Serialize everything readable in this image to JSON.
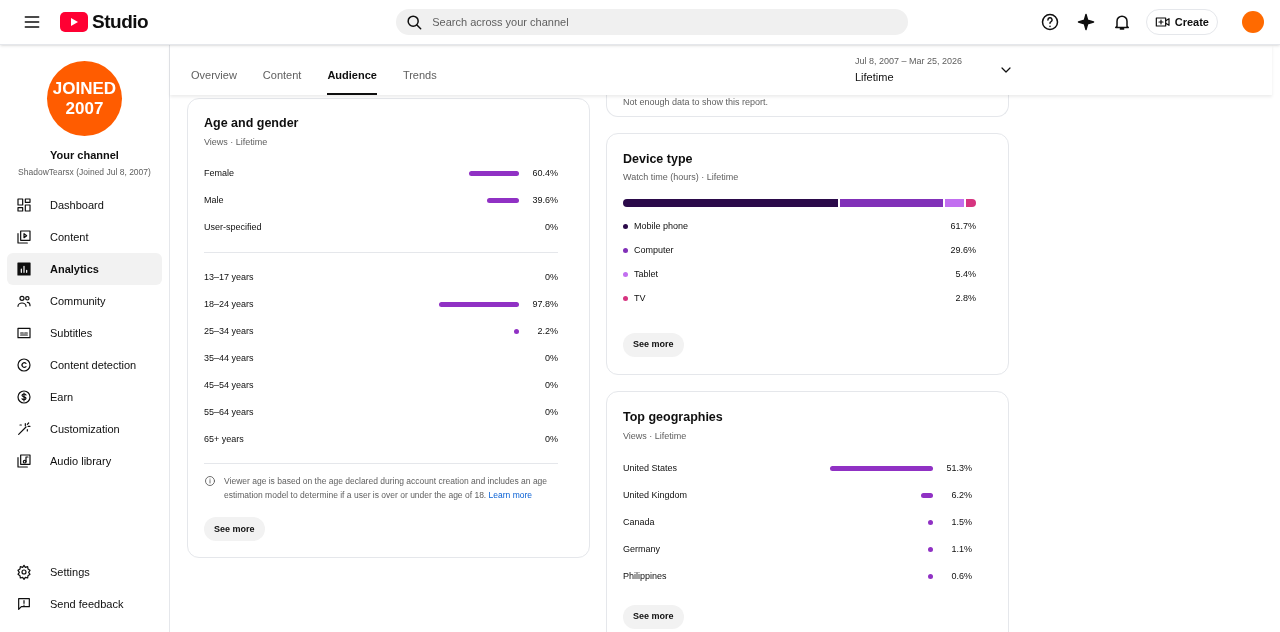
{
  "header": {
    "logo_text": "Studio",
    "search": {
      "placeholder": "Search across your channel"
    },
    "create_label": "Create"
  },
  "sidebar": {
    "avatar_text": [
      "JOINED",
      "2007"
    ],
    "channel_title": "Your channel",
    "channel_subtitle": "ShadowTearsx (Joined Jul 8, 2007)",
    "items": [
      {
        "label": "Dashboard",
        "selected": false
      },
      {
        "label": "Content",
        "selected": false
      },
      {
        "label": "Analytics",
        "selected": true
      },
      {
        "label": "Community",
        "selected": false
      },
      {
        "label": "Subtitles",
        "selected": false
      },
      {
        "label": "Content detection",
        "selected": false
      },
      {
        "label": "Earn",
        "selected": false
      },
      {
        "label": "Customization",
        "selected": false
      },
      {
        "label": "Audio library",
        "selected": false
      }
    ],
    "footer_items": [
      {
        "label": "Settings"
      },
      {
        "label": "Send feedback"
      }
    ]
  },
  "tabs": [
    {
      "label": "Overview",
      "selected": false
    },
    {
      "label": "Content",
      "selected": false
    },
    {
      "label": "Audience",
      "selected": true
    },
    {
      "label": "Trends",
      "selected": false
    }
  ],
  "date_range": {
    "range": "Jul 8, 2007 – Mar 25, 2026",
    "label": "Lifetime"
  },
  "age_gender": {
    "title": "Age and gender",
    "subtitle": "Views · Lifetime",
    "gender_rows": [
      {
        "label": "Female",
        "value": "60.4%"
      },
      {
        "label": "Male",
        "value": "39.6%"
      },
      {
        "label": "User-specified",
        "value": "0%"
      }
    ],
    "age_rows": [
      {
        "label": "13–17 years",
        "value": "0%"
      },
      {
        "label": "18–24 years",
        "value": "97.8%"
      },
      {
        "label": "25–34 years",
        "value": "2.2%"
      },
      {
        "label": "35–44 years",
        "value": "0%"
      },
      {
        "label": "45–54 years",
        "value": "0%"
      },
      {
        "label": "55–64 years",
        "value": "0%"
      },
      {
        "label": "65+ years",
        "value": "0%"
      }
    ],
    "note": "Viewer age is based on the age declared during account creation and includes an age estimation model to determine if a user is over or under the age of 18.",
    "note_link": "Learn more",
    "button": "See more"
  },
  "partial_card": {
    "message": "Not enough data to show this report."
  },
  "device_type": {
    "title": "Device type",
    "subtitle": "Watch time (hours) · Lifetime",
    "items": [
      {
        "label": "Mobile phone",
        "value": "61.7%",
        "color": "#2b0a4a"
      },
      {
        "label": "Computer",
        "value": "29.6%",
        "color": "#8130b8"
      },
      {
        "label": "Tablet",
        "value": "5.4%",
        "color": "#c26ff0"
      },
      {
        "label": "TV",
        "value": "2.8%",
        "color": "#d63480"
      }
    ],
    "button": "See more"
  },
  "top_geographies": {
    "title": "Top geographies",
    "subtitle": "Views · Lifetime",
    "rows": [
      {
        "label": "United States",
        "value": "51.3%"
      },
      {
        "label": "United Kingdom",
        "value": "6.2%"
      },
      {
        "label": "Canada",
        "value": "1.5%"
      },
      {
        "label": "Germany",
        "value": "1.1%"
      },
      {
        "label": "Philippines",
        "value": "0.6%"
      }
    ],
    "button": "See more"
  }
}
